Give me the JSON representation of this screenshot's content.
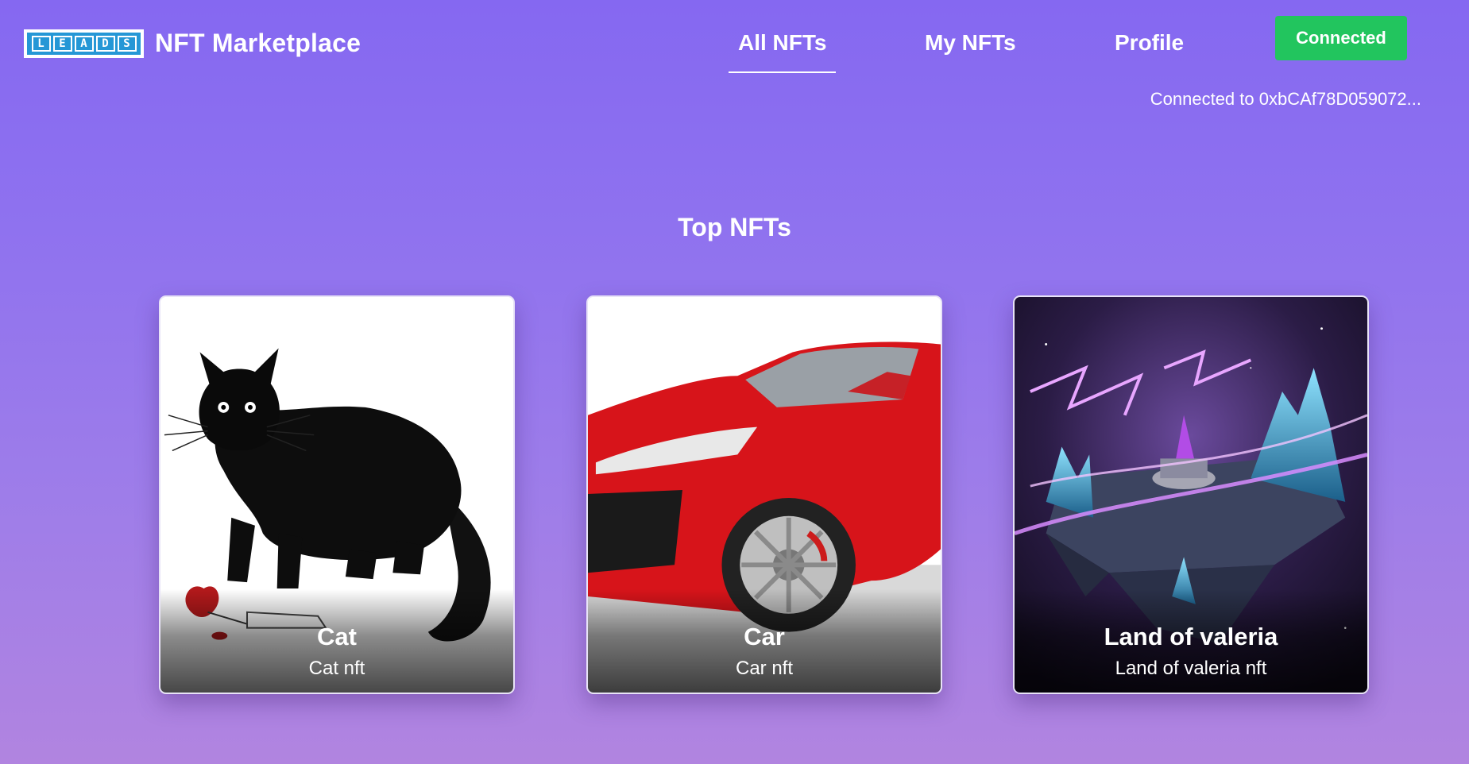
{
  "header": {
    "logo_letters": [
      "L",
      "E",
      "A",
      "D",
      "S"
    ],
    "site_title": "NFT Marketplace",
    "nav": [
      {
        "label": "All NFTs",
        "active": true
      },
      {
        "label": "My NFTs",
        "active": false
      },
      {
        "label": "Profile",
        "active": false
      }
    ],
    "connect_button_label": "Connected",
    "wallet_status": "Connected to 0xbCAf78D059072..."
  },
  "colors": {
    "connect_button": "#22c55e",
    "background_top": "#8568f1",
    "background_bottom": "#b184e0"
  },
  "main": {
    "section_title": "Top NFTs",
    "nfts": [
      {
        "name": "Cat",
        "description": "Cat nft",
        "image": "cat-artwork"
      },
      {
        "name": "Car",
        "description": "Car nft",
        "image": "car-artwork"
      },
      {
        "name": "Land of valeria",
        "description": "Land of valeria nft",
        "image": "fantasy-land-artwork"
      }
    ]
  }
}
